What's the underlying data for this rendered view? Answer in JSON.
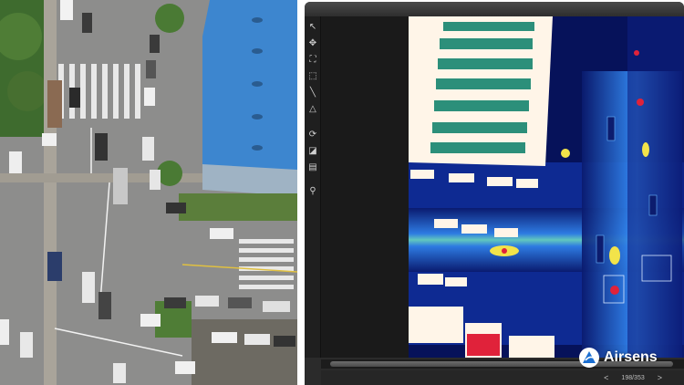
{
  "colors": {
    "viewer_bg": "#2b2b2b",
    "toolbar_bg": "#1f1f1f",
    "thermal_cold": "#0a1a6e",
    "thermal_mid": "#2f7fe6",
    "thermal_warm": "#f2e34a",
    "thermal_hot": "#e0223a",
    "thermal_max": "#fff5e8",
    "roof_blue": "#3d86cf",
    "road_gray": "#8a8a8a"
  },
  "toolbar": {
    "tools": [
      {
        "icon": "pointer-icon",
        "glyph": "↖"
      },
      {
        "icon": "pan-icon",
        "glyph": "✥"
      },
      {
        "icon": "fit-screen-icon",
        "glyph": "⛶"
      },
      {
        "icon": "rectangle-select-icon",
        "glyph": "⬚"
      },
      {
        "icon": "line-measure-icon",
        "glyph": "╲"
      },
      {
        "icon": "polygon-icon",
        "glyph": "△"
      },
      {
        "icon": "rotate-icon",
        "glyph": "⟳"
      },
      {
        "icon": "palette-icon",
        "glyph": "◪"
      },
      {
        "icon": "color-bar-icon",
        "glyph": "▤"
      },
      {
        "icon": "zoom-icon",
        "glyph": "⚲"
      }
    ]
  },
  "pager": {
    "prev": "<",
    "page": "198/353",
    "next": ">"
  },
  "brand": {
    "name": "Airsens"
  }
}
